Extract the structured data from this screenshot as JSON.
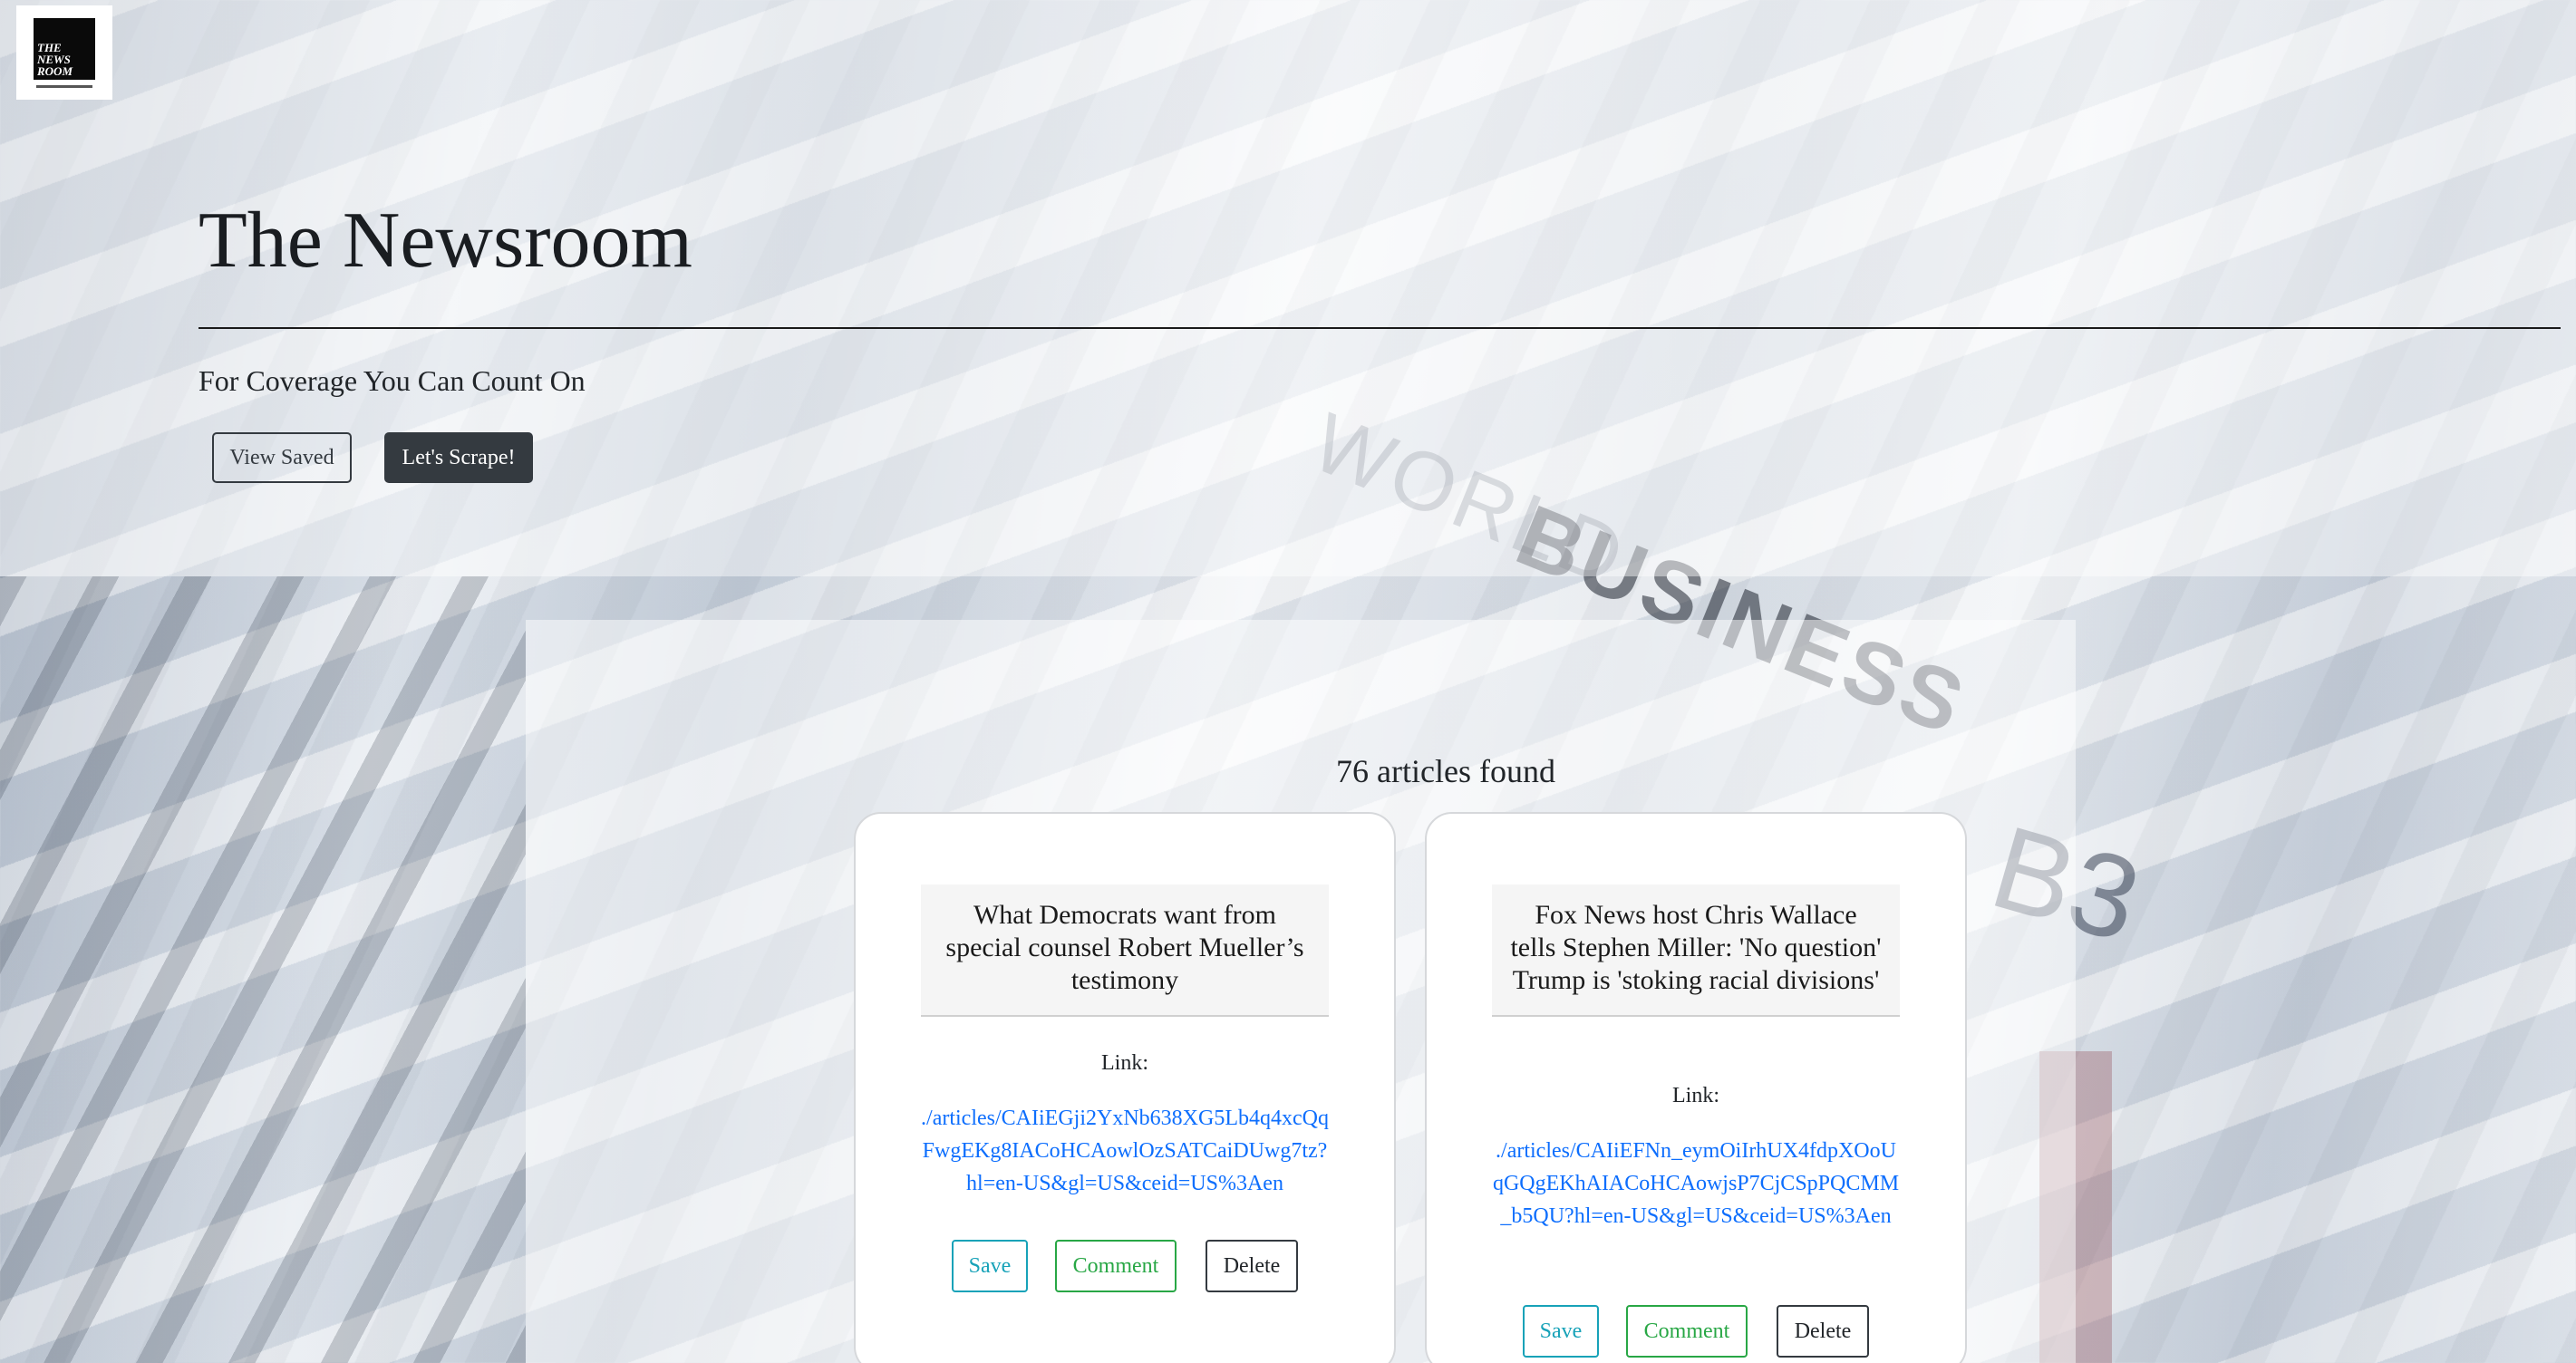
{
  "header": {
    "logo": {
      "line1": "THE",
      "line2": "NEWS",
      "line3": "ROOM"
    },
    "title": "The Newsroom",
    "tagline": "For Coverage You Can Count On",
    "view_saved_label": "View Saved",
    "scrape_label": "Let's Scrape!"
  },
  "background": {
    "text_world": "WORLD",
    "text_business": "BUSINESS",
    "text_b3": "B3"
  },
  "main": {
    "count_text": "76 articles found",
    "articles": [
      {
        "title": "What Democrats want from special counsel Robert Mueller’s testimony",
        "link_label": "Link:",
        "url": "./articles/CAIiEGji2YxNb638XG5Lb4q4xcQqFwgEKg8IACoHCAowlOzSATCaiDUwg7tz?hl=en-US&gl=US&ceid=US%3Aen",
        "save_label": "Save",
        "comment_label": "Comment",
        "delete_label": "Delete"
      },
      {
        "title": "Fox News host Chris Wallace tells Stephen Miller: 'No question' Trump is 'stoking racial divisions'",
        "link_label": "Link:",
        "url": "./articles/CAIiEFNn_eymOiIrhUX4fdpXOoUqGQgEKhAIACoHCAowjsP7CjCSpPQCMM_b5QU?hl=en-US&gl=US&ceid=US%3Aen",
        "save_label": "Save",
        "comment_label": "Comment",
        "delete_label": "Delete"
      }
    ]
  },
  "colors": {
    "dark": "#343a40",
    "link": "#0d6efd",
    "save": "#17a2b8",
    "comment": "#28a745"
  }
}
